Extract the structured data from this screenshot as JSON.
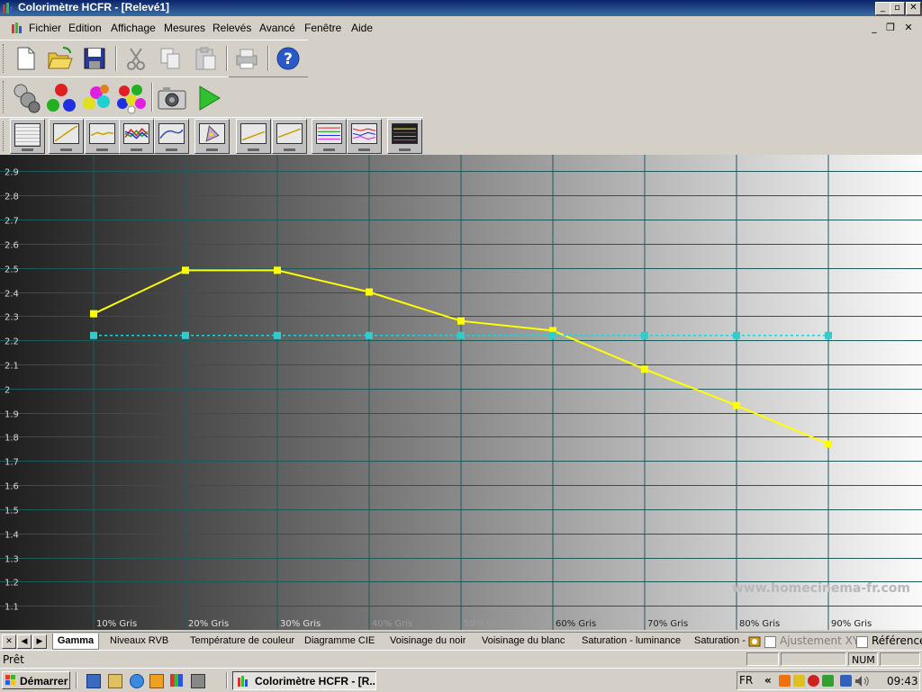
{
  "window": {
    "title": "Colorimètre HCFR - [Relevé1]"
  },
  "menu": [
    "Fichier",
    "Edition",
    "Affichage",
    "Mesures",
    "Relevés",
    "Avancé",
    "Fenêtre",
    "Aide"
  ],
  "toolbar1": [
    "new-file-icon",
    "open-folder-icon",
    "save-icon",
    "cut-icon",
    "copy-icon",
    "paste-icon",
    "print-icon",
    "help-icon"
  ],
  "toolbar2": [
    "sensor-icon",
    "rgb-balls-icon",
    "color-balls-icon",
    "multicolor-balls-icon",
    "camera-icon",
    "play-icon"
  ],
  "toolbar3": [
    "measures-grid-view",
    "gamma-view",
    "luminance-view",
    "rgb-levels-view",
    "color-temp-view",
    "cie-diagram-view",
    "near-black-view",
    "near-white-view",
    "saturation-luminance-view",
    "saturation-shift-view",
    "saturation-cie-view"
  ],
  "chart_data": {
    "type": "line",
    "y_ticks": [
      "2.9",
      "2.8",
      "2.7",
      "2.6",
      "2.5",
      "2.4",
      "2.3",
      "2.2",
      "2.1",
      "2",
      "1.9",
      "1.8",
      "1.7",
      "1.6",
      "1.5",
      "1.4",
      "1.3",
      "1.2",
      "1.1"
    ],
    "ylim": [
      1,
      2.95
    ],
    "categories": [
      "10% Gris",
      "20% Gris",
      "30% Gris",
      "40% Gris",
      "50% Gris",
      "60% Gris",
      "70% Gris",
      "80% Gris",
      "90% Gris"
    ],
    "series": [
      {
        "role": "measured-gamma",
        "color": "#ffff00",
        "values": [
          2.31,
          2.49,
          2.49,
          2.4,
          2.28,
          2.24,
          2.08,
          1.93,
          1.77
        ]
      },
      {
        "role": "reference-gamma",
        "color": "#33cccc",
        "values": [
          2.22,
          2.22,
          2.22,
          2.22,
          2.22,
          2.22,
          2.22,
          2.22,
          2.22
        ]
      }
    ],
    "watermark": "www.homecinema-fr.com",
    "grid": true
  },
  "tabs": {
    "items": [
      "Gamma",
      "Niveaux RVB",
      "Température de couleur",
      "Diagramme CIE",
      "Voisinage du noir",
      "Voisinage du blanc",
      "Saturation - luminance",
      "Saturation - éc"
    ],
    "active": "Gamma",
    "checkbox_xyz": "Ajustement XYZ",
    "checkbox_ref": "Référence"
  },
  "status": {
    "text": "Prêt",
    "num": "NUM"
  },
  "taskbar": {
    "start": "Démarrer",
    "task": "Colorimètre HCFR - [R...",
    "lang": "FR",
    "chevron": "«",
    "clock": "09:43"
  }
}
